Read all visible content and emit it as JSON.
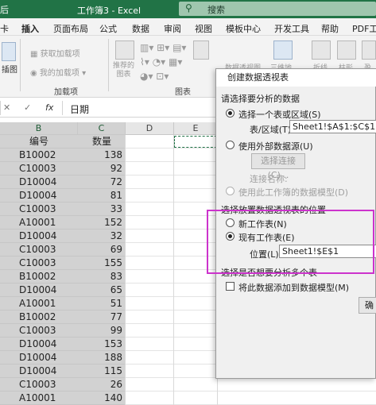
{
  "title_bar": {
    "left_fragment": "后",
    "title": "工作簿3  -  Excel",
    "search_placeholder": "搜索",
    "search_icon": "search-icon"
  },
  "menu_tabs": [
    {
      "label": "卡"
    },
    {
      "label": "插入",
      "active": true
    },
    {
      "label": "页面布局"
    },
    {
      "label": "公式"
    },
    {
      "label": "数据"
    },
    {
      "label": "审阅"
    },
    {
      "label": "视图"
    },
    {
      "label": "模板中心"
    },
    {
      "label": "开发工具"
    },
    {
      "label": "帮助"
    },
    {
      "label": "PDF工"
    }
  ],
  "ribbon": {
    "insert_illustration": "插图",
    "get_addins": "获取加载项",
    "my_addins": "我的加载项",
    "addins_group": "加载项",
    "recommended_charts": "推荐的\n图表",
    "charts_group": "图表",
    "data_pivot": "数据透视图",
    "three_d_map": "三维地",
    "line": "折线",
    "column": "柱形",
    "sparkline": "盈"
  },
  "formula_bar": {
    "cancel": "✕",
    "confirm": "✓",
    "fx": "fx",
    "value": "日期"
  },
  "sheet": {
    "columns": [
      "B",
      "C",
      "D",
      "E"
    ],
    "header_row": {
      "b": "编号",
      "c": "数量"
    },
    "rows": [
      {
        "b": "B10002",
        "c": "138"
      },
      {
        "b": "C10003",
        "c": "92"
      },
      {
        "b": "D10004",
        "c": "72"
      },
      {
        "b": "D10004",
        "c": "81"
      },
      {
        "b": "C10003",
        "c": "33"
      },
      {
        "b": "A10001",
        "c": "152"
      },
      {
        "b": "D10004",
        "c": "32"
      },
      {
        "b": "C10003",
        "c": "69"
      },
      {
        "b": "C10003",
        "c": "155"
      },
      {
        "b": "B10002",
        "c": "83"
      },
      {
        "b": "D10004",
        "c": "65"
      },
      {
        "b": "A10001",
        "c": "51"
      },
      {
        "b": "B10002",
        "c": "77"
      },
      {
        "b": "C10003",
        "c": "99"
      },
      {
        "b": "D10004",
        "c": "153"
      },
      {
        "b": "D10004",
        "c": "188"
      },
      {
        "b": "D10004",
        "c": "115"
      },
      {
        "b": "C10003",
        "c": "26"
      },
      {
        "b": "A10001",
        "c": "140"
      }
    ]
  },
  "dialog": {
    "title": "创建数据透视表",
    "section1": "请选择要分析的数据",
    "opt_range": "选择一个表或区域(S)",
    "range_label": "表/区域(T):",
    "range_value": "Sheet1!$A$1:$C$126",
    "opt_external": "使用外部数据源(U)",
    "choose_conn": "选择连接(C)...",
    "conn_name": "连接名称:",
    "opt_model": "使用此工作簿的数据模型(D)",
    "section2": "选择放置数据透视表的位置",
    "opt_new": "新工作表(N)",
    "opt_existing": "现有工作表(E)",
    "location_label": "位置(L):",
    "location_value": "Sheet1!$E$1",
    "section3": "选择是否想要分析多个表",
    "add_model": "将此数据添加到数据模型(M)",
    "ok_fragment": "确"
  },
  "colors": {
    "excel_green": "#217346",
    "highlight": "#cc33cc"
  }
}
